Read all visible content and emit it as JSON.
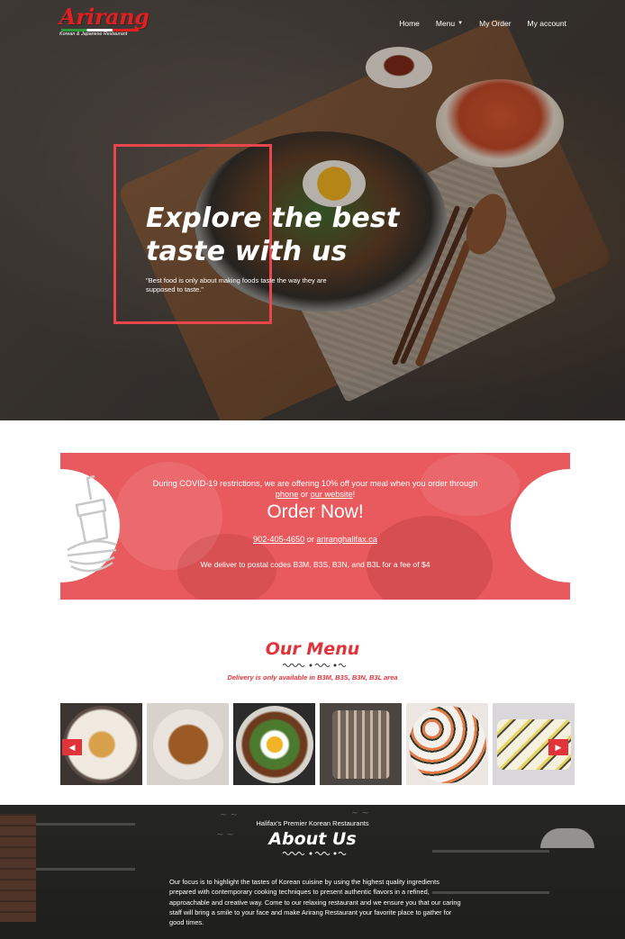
{
  "header": {
    "logo_text": "Arirang",
    "logo_tagline": "Korean & Japanese Restaurant",
    "nav": [
      {
        "label": "Home"
      },
      {
        "label": "Menu"
      },
      {
        "label": "My Order"
      },
      {
        "label": "My account"
      }
    ]
  },
  "hero": {
    "title_line1": "Explore the best",
    "title_line2": "taste with us",
    "quote": "\"Best food is only about making foods taste the way they are supposed to taste.\""
  },
  "promo": {
    "text_before_phone": "During COVID-19 restrictions, we are offering 10% off your meal when you order through ",
    "phone_link": "phone",
    "text_or": " or ",
    "website_link": "our website",
    "text_end": "!",
    "heading": "Order Now!",
    "phone_number": "902-405-4650",
    "links_or": " or ",
    "website_url": "ariranghalifax.ca",
    "delivery_note": "We deliver to postal codes B3M, B3S, B3N, and B3L for a fee of $4"
  },
  "menu_section": {
    "title": "Our Menu",
    "subtitle": "Delivery is only available in B3M, B3S, B3N, B3L area",
    "items": [
      {
        "icon": "tempura-dish"
      },
      {
        "icon": "noodle-dish"
      },
      {
        "icon": "bibimbap-dish"
      },
      {
        "icon": "bbq-grill-dish"
      },
      {
        "icon": "sushi-roll-dish"
      },
      {
        "icon": "sushi-platter-dish"
      }
    ],
    "prev_icon": "chevron-left-icon",
    "next_icon": "chevron-right-icon"
  },
  "about": {
    "eyebrow": "Halifax's Premier Korean Restaurants",
    "title": "About Us",
    "body": "Our focus is to highlight the tastes of Korean cuisine by using the highest quality ingredients prepared with contemporary cooking techniques to present authentic flavors in a refined, approachable and creative way. Come to our relaxing restaurant and we ensure you that our caring staff will bring a smile to your face and make Arirang Restaurant your favorite place to gather for good times."
  },
  "colors": {
    "accent": "#e1333a",
    "promo_bg": "#e85a5e",
    "logo_red": "#e51f1f"
  }
}
